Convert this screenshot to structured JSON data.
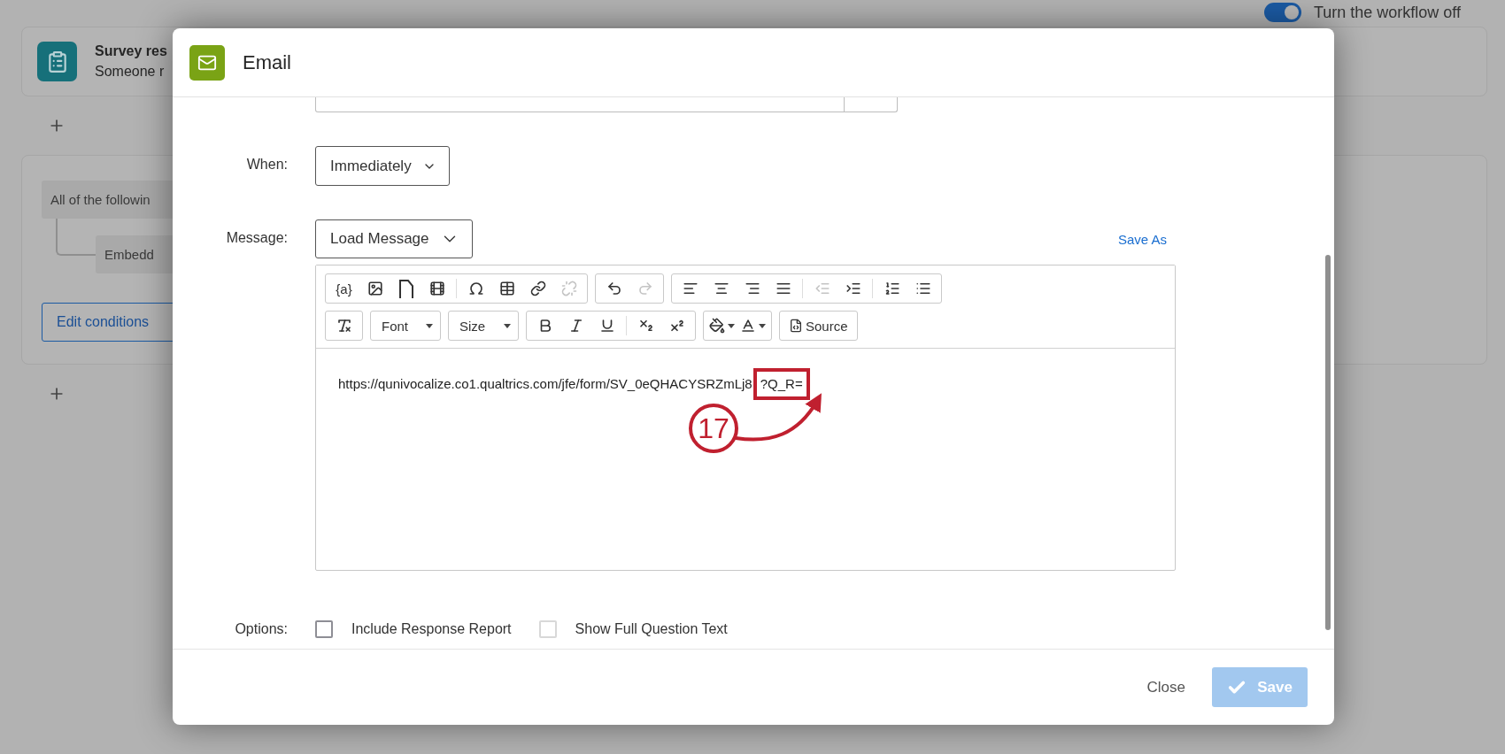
{
  "background": {
    "toggle": {
      "on": true,
      "label": "Turn the workflow off"
    },
    "trigger": {
      "title": "Survey res",
      "subtitle": "Someone r"
    },
    "conditions": {
      "group": "All of the followin",
      "condition": "Embedd",
      "button": "Edit conditions"
    }
  },
  "dialog": {
    "title": "Email",
    "when": {
      "label": "When:",
      "value": "Immediately"
    },
    "message": {
      "label": "Message:",
      "load": "Load Message",
      "save_as": "Save As"
    },
    "toolbar": [
      [
        {
          "items": [
            {
              "kind": "variable",
              "label": "{a}",
              "disabled": false
            },
            {
              "kind": "image",
              "disabled": false
            },
            {
              "kind": "page",
              "disabled": false
            },
            {
              "kind": "film",
              "disabled": false
            },
            {
              "kind": "separator"
            },
            {
              "kind": "omega",
              "disabled": false
            },
            {
              "kind": "table",
              "disabled": false
            },
            {
              "kind": "link",
              "disabled": false
            },
            {
              "kind": "unlink",
              "disabled": true
            }
          ]
        },
        {
          "items": [
            {
              "kind": "undo",
              "disabled": false
            },
            {
              "kind": "redo",
              "disabled": true
            }
          ]
        },
        {
          "items": [
            {
              "kind": "align-left",
              "disabled": false
            },
            {
              "kind": "align-center",
              "disabled": false
            },
            {
              "kind": "align-right",
              "disabled": false
            },
            {
              "kind": "align-justify",
              "disabled": false
            },
            {
              "kind": "separator"
            },
            {
              "kind": "outdent",
              "disabled": true
            },
            {
              "kind": "indent",
              "disabled": false
            },
            {
              "kind": "separator"
            },
            {
              "kind": "ordered-list",
              "disabled": false
            },
            {
              "kind": "bullet-list",
              "disabled": false
            }
          ]
        }
      ],
      [
        {
          "items": [
            {
              "kind": "clear-format",
              "disabled": false
            }
          ]
        },
        {
          "items": [
            {
              "kind": "dropdown",
              "label": "Font",
              "disabled": false
            }
          ]
        },
        {
          "items": [
            {
              "kind": "dropdown",
              "label": "Size",
              "disabled": false
            }
          ]
        },
        {
          "items": [
            {
              "kind": "bold",
              "disabled": false
            },
            {
              "kind": "italic",
              "disabled": false
            },
            {
              "kind": "underline",
              "disabled": false
            },
            {
              "kind": "separator"
            },
            {
              "kind": "subscript",
              "disabled": false
            },
            {
              "kind": "superscript",
              "disabled": false
            }
          ]
        },
        {
          "items": [
            {
              "kind": "background-color",
              "disabled": false
            },
            {
              "kind": "text-color",
              "disabled": false
            }
          ]
        },
        {
          "items": [
            {
              "kind": "source",
              "label": "Source",
              "disabled": false
            }
          ]
        }
      ]
    ],
    "content": {
      "text": "https://qunivocalize.co1.qualtrics.com/jfe/form/SV_0eQHACYSRZmLj8",
      "highlight": "?Q_R=",
      "step": "17"
    },
    "options": {
      "label": "Options:",
      "items": [
        {
          "label": "Include Response Report",
          "checked": false,
          "disabled": false
        },
        {
          "label": "Show Full Question Text",
          "checked": false,
          "disabled": true
        }
      ]
    },
    "close": "Close",
    "save": {
      "label": "Save",
      "disabled": true
    }
  }
}
